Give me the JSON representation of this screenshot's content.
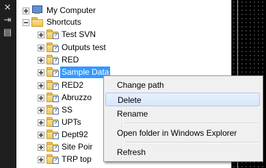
{
  "sidebar": {
    "close_glyph": "✕",
    "pin_glyph": "⇥",
    "panel_glyph": "▤"
  },
  "tree": {
    "my_computer": "My Computer",
    "shortcuts": "Shortcuts",
    "items": [
      {
        "label": "Test SVN"
      },
      {
        "label": "Outputs test"
      },
      {
        "label": "RED"
      },
      {
        "label": "Sample Data"
      },
      {
        "label": "RED2"
      },
      {
        "label": "Abruzzo"
      },
      {
        "label": "SS"
      },
      {
        "label": "UPTs"
      },
      {
        "label": "Dept92"
      },
      {
        "label": "Site Poir"
      },
      {
        "label": "TRP top"
      }
    ],
    "selected_item": "Sample Data"
  },
  "context_menu": {
    "items": [
      {
        "label": "Change path"
      },
      {
        "label": "Delete"
      },
      {
        "label": "Rename"
      },
      {
        "label": "Open folder in Windows Explorer"
      },
      {
        "label": "Refresh"
      }
    ],
    "highlighted": "Delete"
  },
  "colors": {
    "selection": "#3399ff",
    "menu_bg": "#f0f0f0",
    "highlight": "#d6e6fa"
  }
}
